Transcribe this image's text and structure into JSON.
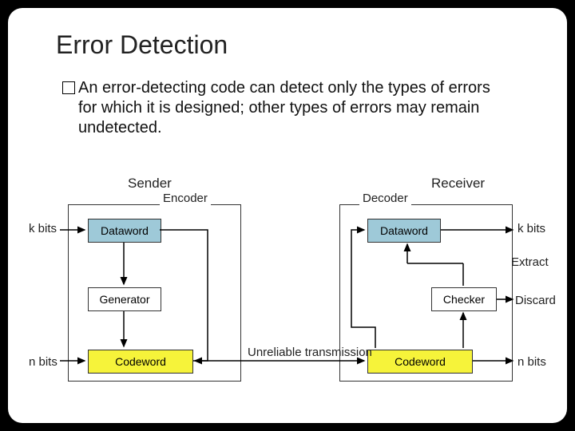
{
  "title": "Error Detection",
  "bullet": "An error-detecting code can detect only the types of errors for which it is designed; other types of errors may remain undetected.",
  "diagram": {
    "sender": "Sender",
    "receiver": "Receiver",
    "encoder": "Encoder",
    "decoder": "Decoder",
    "dataword": "Dataword",
    "generator": "Generator",
    "codeword": "Codeword",
    "checker": "Checker",
    "extract": "Extract",
    "discard": "Discard",
    "kbits": "k bits",
    "nbits": "n bits",
    "unreliable": "Unreliable transmission"
  }
}
